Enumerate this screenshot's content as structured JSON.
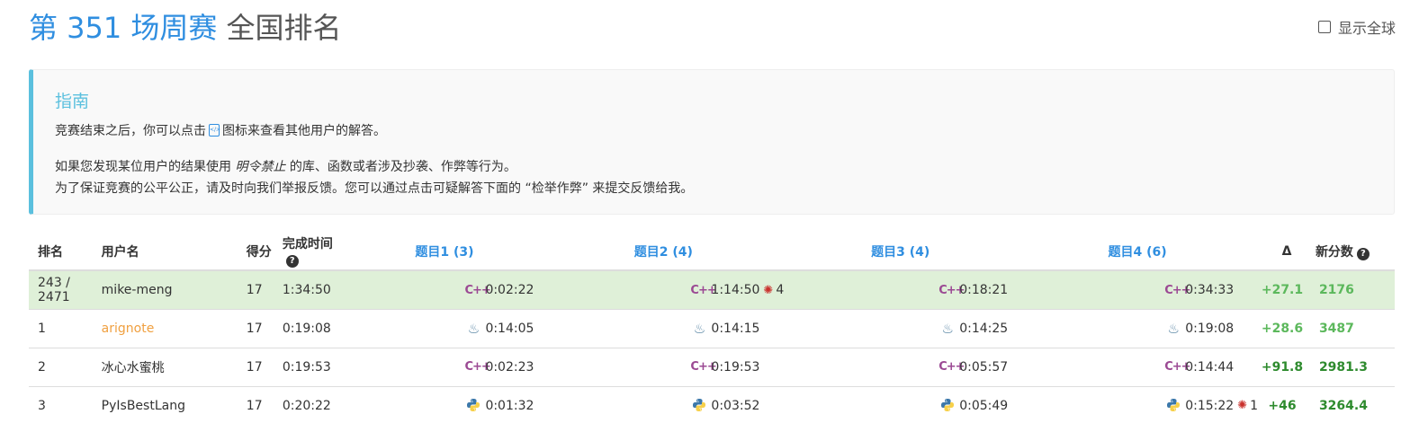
{
  "header": {
    "contest_title": "第 351 场周赛",
    "rank_title": "全国排名",
    "global_toggle_label": "显示全球"
  },
  "guide": {
    "title": "指南",
    "line1_before_icon": "竞赛结束之后，你可以点击",
    "line1_after_icon": "图标来查看其他用户的解答。",
    "line2_before": "如果您发现某位用户的结果使用",
    "line2_emphasis": "明令禁止",
    "line2_after": "的库、函数或者涉及抄袭、作弊等行为。",
    "line3": "为了保证竞赛的公平公正，请及时向我们举报反馈。您可以通过点击可疑解答下面的 “检举作弊” 来提交反馈给我。"
  },
  "table": {
    "headers": {
      "rank": "排名",
      "username": "用户名",
      "score": "得分",
      "finish_time": "完成时间",
      "q1": "题目1 (3)",
      "q2": "题目2 (4)",
      "q3": "题目3 (4)",
      "q4": "题目4 (6)",
      "delta": "Δ",
      "new_rating": "新分数"
    },
    "rows": [
      {
        "rank": "243 / 2471",
        "username": "mike-meng",
        "score": "17",
        "finish_time": "1:34:50",
        "q1": {
          "lang": "cpp",
          "time": "0:02:22",
          "bugs": ""
        },
        "q2": {
          "lang": "cpp",
          "time": "1:14:50",
          "bugs": "4"
        },
        "q3": {
          "lang": "cpp",
          "time": "0:18:21",
          "bugs": ""
        },
        "q4": {
          "lang": "cpp",
          "time": "0:34:33",
          "bugs": ""
        },
        "delta": "+27.1",
        "new_rating": "2176"
      },
      {
        "rank": "1",
        "username": "arignote",
        "score": "17",
        "finish_time": "0:19:08",
        "q1": {
          "lang": "java",
          "time": "0:14:05",
          "bugs": ""
        },
        "q2": {
          "lang": "java",
          "time": "0:14:15",
          "bugs": ""
        },
        "q3": {
          "lang": "java",
          "time": "0:14:25",
          "bugs": ""
        },
        "q4": {
          "lang": "java",
          "time": "0:19:08",
          "bugs": ""
        },
        "delta": "+28.6",
        "new_rating": "3487"
      },
      {
        "rank": "2",
        "username": "冰心水蜜桃",
        "score": "17",
        "finish_time": "0:19:53",
        "q1": {
          "lang": "cpp",
          "time": "0:02:23",
          "bugs": ""
        },
        "q2": {
          "lang": "cpp",
          "time": "0:19:53",
          "bugs": ""
        },
        "q3": {
          "lang": "cpp",
          "time": "0:05:57",
          "bugs": ""
        },
        "q4": {
          "lang": "cpp",
          "time": "0:14:44",
          "bugs": ""
        },
        "delta": "+91.8",
        "new_rating": "2981.3"
      },
      {
        "rank": "3",
        "username": "PyIsBestLang",
        "score": "17",
        "finish_time": "0:20:22",
        "q1": {
          "lang": "python",
          "time": "0:01:32",
          "bugs": ""
        },
        "q2": {
          "lang": "python",
          "time": "0:03:52",
          "bugs": ""
        },
        "q3": {
          "lang": "python",
          "time": "0:05:49",
          "bugs": ""
        },
        "q4": {
          "lang": "python",
          "time": "0:15:22",
          "bugs": "1"
        },
        "delta": "+46",
        "new_rating": "3264.4"
      }
    ]
  },
  "colors": {
    "accent_blue": "#2f8ee0",
    "guide_blue": "#5bc0de",
    "highlight_row": "#dff0d8",
    "positive_green": "#5cb85c",
    "username_orange": "#f0a040",
    "bug_red": "#c9302c"
  },
  "icons": {
    "checkbox": "checkbox-icon",
    "info": "info-icon",
    "solution": "code-file-icon",
    "cpp": "cpp-icon",
    "java": "java-icon",
    "python": "python-icon",
    "bug": "bug-icon"
  }
}
